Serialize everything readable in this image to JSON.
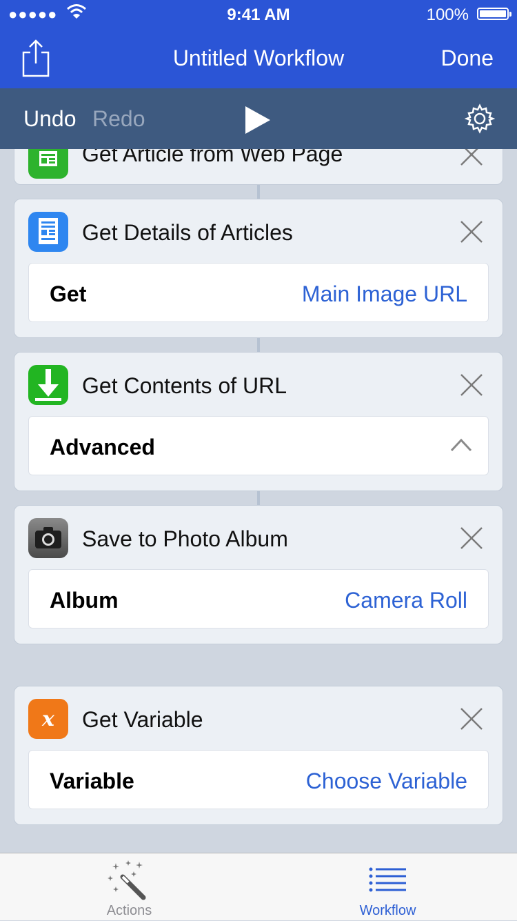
{
  "status": {
    "signal": "●●●●●",
    "time": "9:41 AM",
    "battery_pct": "100%"
  },
  "nav": {
    "title": "Untitled Workflow",
    "done_label": "Done",
    "share_icon": "share-icon"
  },
  "toolbar": {
    "undo_label": "Undo",
    "redo_label": "Redo",
    "play_icon": "play-icon",
    "settings_icon": "gear-icon"
  },
  "actions": [
    {
      "title": "Get Article from Web Page",
      "icon": "article-icon",
      "color": "#2db32d"
    },
    {
      "title": "Get Details of Articles",
      "icon": "document-icon",
      "color": "#2e86f0",
      "param_label": "Get",
      "param_value": "Main Image URL"
    },
    {
      "title": "Get Contents of URL",
      "icon": "download-icon",
      "color": "#22b522",
      "param_label": "Advanced"
    },
    {
      "title": "Save to Photo Album",
      "icon": "camera-icon",
      "color": "#6b6b6b",
      "param_label": "Album",
      "param_value": "Camera Roll"
    },
    {
      "title": "Get Variable",
      "icon": "variable-icon",
      "color": "#f07818",
      "param_label": "Variable",
      "param_value": "Choose Variable"
    }
  ],
  "tabs": {
    "actions_label": "Actions",
    "workflow_label": "Workflow"
  },
  "colors": {
    "nav_blue": "#2b55d6",
    "toolbar_slate": "#3e5a80",
    "link_blue": "#2d62d4",
    "background": "#cfd6e0"
  }
}
